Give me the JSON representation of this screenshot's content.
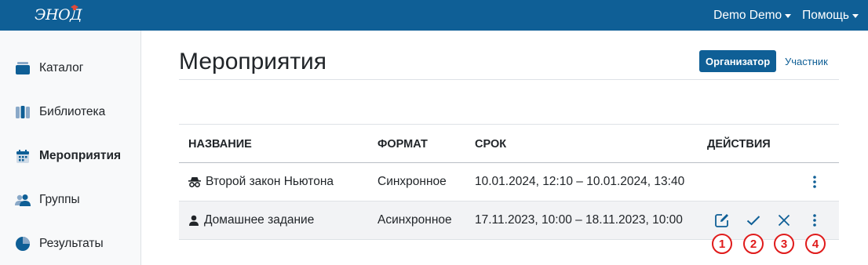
{
  "header": {
    "logo_text": "ЭНОД",
    "user_menu": "Demo Demo",
    "help_menu": "Помощь"
  },
  "sidebar": {
    "items": [
      {
        "label": "Каталог",
        "icon": "catalog-icon"
      },
      {
        "label": "Библиотека",
        "icon": "library-icon"
      },
      {
        "label": "Мероприятия",
        "icon": "calendar-icon",
        "active": true
      },
      {
        "label": "Группы",
        "icon": "users-icon"
      },
      {
        "label": "Результаты",
        "icon": "pie-chart-icon"
      }
    ]
  },
  "main": {
    "title": "Мероприятия",
    "role_tabs": {
      "organizer": "Организатор",
      "participant": "Участник",
      "selected": "organizer"
    },
    "table": {
      "columns": [
        "НАЗВАНИЕ",
        "ФОРМАТ",
        "СРОК",
        "ДЕЙСТВИЯ"
      ],
      "rows": [
        {
          "icon": "incognito-icon",
          "name": "Второй закон Ньютона",
          "format": "Синхронное",
          "period": "10.01.2024, 12:10 – 10.01.2024, 13:40",
          "actions": [
            "more"
          ]
        },
        {
          "icon": "person-icon",
          "name": "Домашнее задание",
          "format": "Асинхронное",
          "period": "17.11.2023, 10:00 – 18.11.2023, 10:00",
          "actions": [
            "edit",
            "confirm",
            "delete",
            "more"
          ]
        }
      ]
    },
    "annotations": [
      "1",
      "2",
      "3",
      "4"
    ]
  },
  "colors": {
    "brand": "#0f5f96",
    "annotation": "#e01b1b"
  }
}
